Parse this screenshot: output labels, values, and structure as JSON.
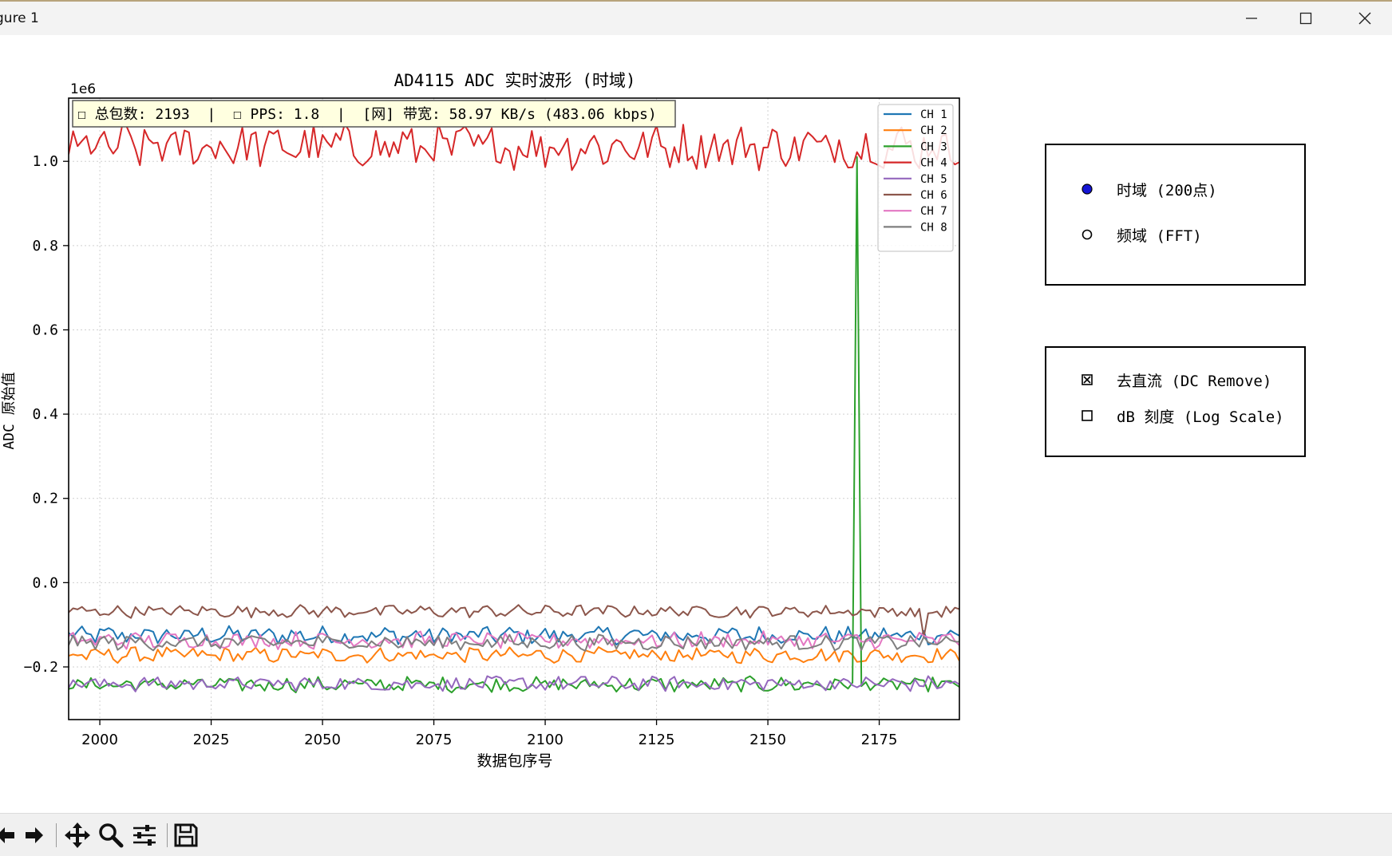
{
  "window": {
    "title": "gure 1",
    "minimize_glyph": "—",
    "maximize_glyph": "☐",
    "close_glyph": "✕"
  },
  "chart_data": {
    "type": "line",
    "title": "AD4115 ADC 实时波形 (时域)",
    "xlabel": "数据包序号",
    "ylabel": "ADC 原始值",
    "y_offset_text": "1e6",
    "xlim": [
      1993,
      2193
    ],
    "ylim": [
      -0.325,
      1.15
    ],
    "xticks": [
      2000,
      2025,
      2050,
      2075,
      2100,
      2125,
      2150,
      2175
    ],
    "xtick_labels": [
      "2000",
      "2025",
      "2050",
      "2075",
      "2100",
      "2125",
      "2150",
      "2175"
    ],
    "yticks": [
      -0.2,
      0.0,
      0.2,
      0.4,
      0.6,
      0.8,
      1.0
    ],
    "ytick_labels": [
      "−0.2",
      "0.0",
      "0.2",
      "0.4",
      "0.6",
      "0.8",
      "1.0"
    ],
    "grid": true,
    "legend_position": "top-right",
    "info_box": "☐ 总包数: 2193  |  ☐ PPS: 1.8  |  [网] 带宽: 58.97 KB/s (483.06 kbps)",
    "x_start": 1993,
    "x_step": 1,
    "series": [
      {
        "name": "CH 1",
        "color": "#1f77b4",
        "base": -0.125,
        "amp": 0.012
      },
      {
        "name": "CH 2",
        "color": "#ff7f0e",
        "base": -0.172,
        "amp": 0.01
      },
      {
        "name": "CH 3",
        "color": "#2ca02c",
        "base": -0.242,
        "amp": 0.01,
        "spike": {
          "x": 2170,
          "y": 1.01
        }
      },
      {
        "name": "CH 4",
        "color": "#d62728",
        "base": 1.035,
        "amp": 0.03
      },
      {
        "name": "CH 5",
        "color": "#9467bd",
        "base": -0.24,
        "amp": 0.01
      },
      {
        "name": "CH 6",
        "color": "#8c564b",
        "base": -0.068,
        "amp": 0.008,
        "dip": {
          "x": 2185,
          "y": -0.13
        }
      },
      {
        "name": "CH 7",
        "color": "#e377c2",
        "base": -0.137,
        "amp": 0.011
      },
      {
        "name": "CH 8",
        "color": "#7f7f7f",
        "base": -0.142,
        "amp": 0.01
      }
    ]
  },
  "controls": {
    "mode_options": [
      {
        "label": "时域 (200点)",
        "selected": true
      },
      {
        "label": "频域 (FFT)",
        "selected": false
      }
    ],
    "check_options": [
      {
        "label": "去直流 (DC Remove)",
        "checked": true
      },
      {
        "label": "dB 刻度 (Log Scale)",
        "checked": false
      }
    ]
  },
  "toolbar": {
    "buttons": [
      "back-icon",
      "forward-icon",
      "pan-icon",
      "zoom-icon",
      "configure-icon",
      "save-icon"
    ]
  }
}
